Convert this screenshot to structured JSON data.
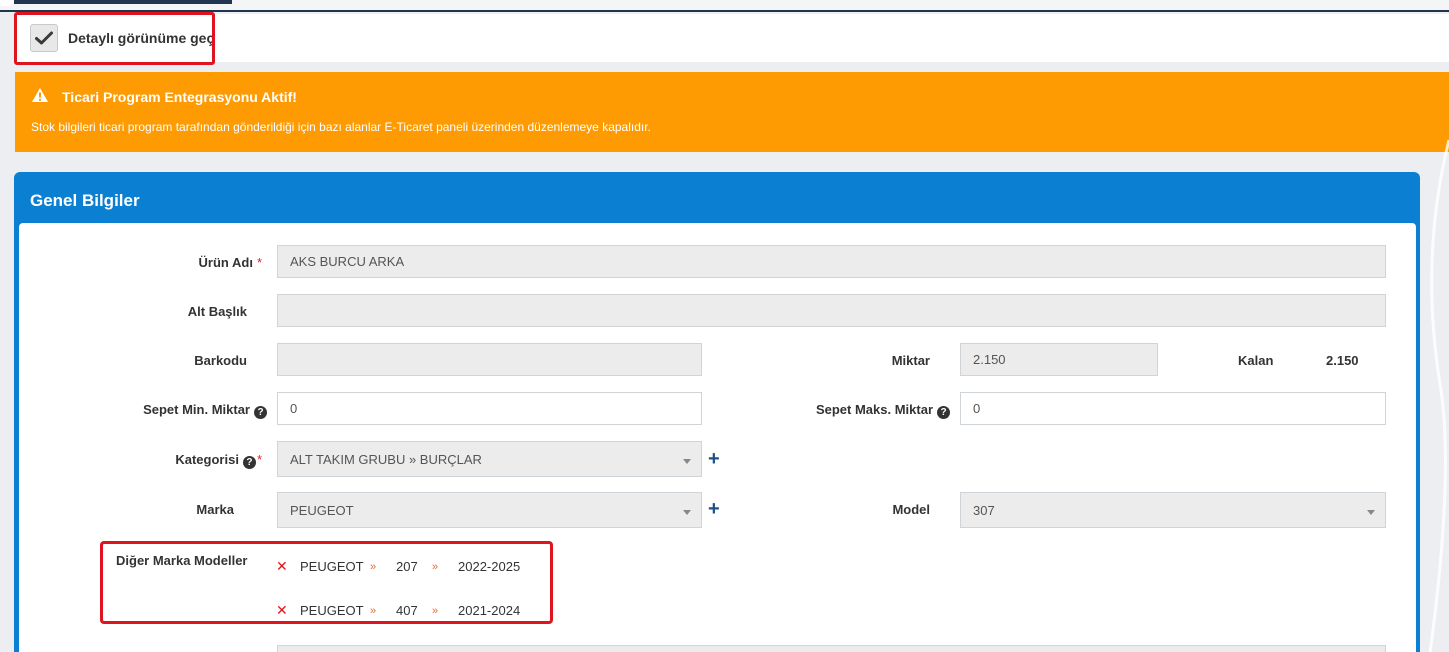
{
  "toggle": {
    "label": "Detaylı görünüme geç",
    "checked": true
  },
  "alert": {
    "title": "Ticari Program Entegrasyonu Aktif!",
    "message": "Stok bilgileri ticari program tarafından gönderildiği için bazı alanlar E-Ticaret paneli üzerinden düzenlemeye kapalıdır.",
    "color": "#fe9b03"
  },
  "panel": {
    "title": "Genel Bilgiler",
    "color": "#0b7fd1"
  },
  "form": {
    "product_name": {
      "label": "Ürün Adı",
      "required": "*",
      "value": "AKS BURCU ARKA"
    },
    "subtitle": {
      "label": "Alt Başlık",
      "value": ""
    },
    "barcode": {
      "label": "Barkodu",
      "value": ""
    },
    "quantity": {
      "label": "Miktar",
      "value": "2.150"
    },
    "remaining": {
      "label": "Kalan",
      "value": "2.150"
    },
    "cart_min": {
      "label": "Sepet Min. Miktar",
      "value": "0"
    },
    "cart_max": {
      "label": "Sepet Maks. Miktar",
      "value": "0"
    },
    "category": {
      "label": "Kategorisi",
      "required": "*",
      "value": "ALT TAKIM GRUBU » BURÇLAR"
    },
    "brand": {
      "label": "Marka",
      "value": "PEUGEOT"
    },
    "model": {
      "label": "Model",
      "value": "307"
    },
    "other_models": {
      "label": "Diğer Marka Modeller",
      "separator": "»",
      "items": [
        {
          "brand": "PEUGEOT",
          "model": "207",
          "years": "2022-2025"
        },
        {
          "brand": "PEUGEOT",
          "model": "407",
          "years": "2021-2024"
        }
      ]
    }
  }
}
